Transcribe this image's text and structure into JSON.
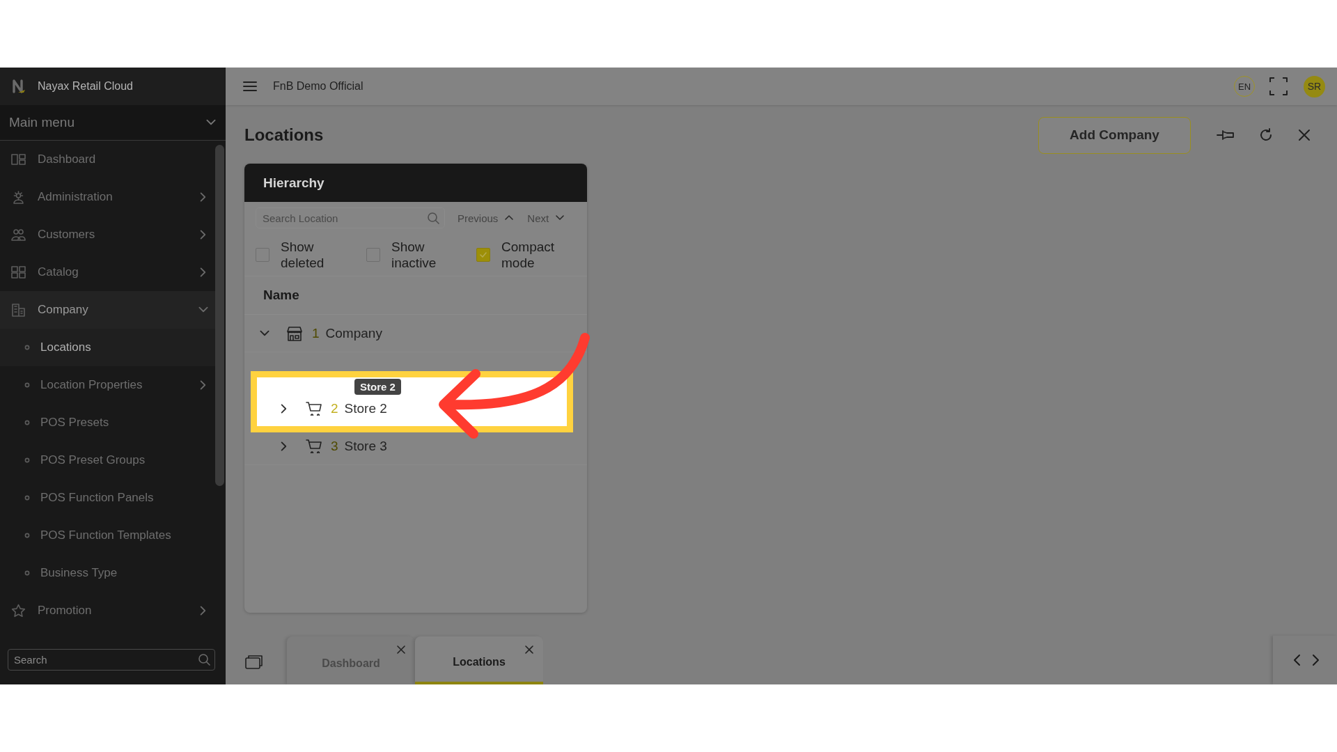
{
  "app": {
    "name": "Nayax Retail Cloud",
    "workspace": "FnB Demo Official"
  },
  "header": {
    "language": "EN",
    "user_initials": "SR"
  },
  "sidebar": {
    "menu_title": "Main menu",
    "items": [
      {
        "label": "Dashboard",
        "kind": "link",
        "selected": false
      },
      {
        "label": "Administration",
        "kind": "group",
        "selected": false,
        "expanded": false
      },
      {
        "label": "Customers",
        "kind": "group",
        "selected": false,
        "expanded": false
      },
      {
        "label": "Catalog",
        "kind": "group",
        "selected": false,
        "expanded": false
      },
      {
        "label": "Company",
        "kind": "group",
        "selected": true,
        "expanded": true,
        "children": [
          {
            "label": "Locations",
            "kind": "link",
            "selected": true
          },
          {
            "label": "Location Properties",
            "kind": "group",
            "selected": false,
            "expanded": false
          },
          {
            "label": "POS Presets",
            "kind": "link",
            "selected": false
          },
          {
            "label": "POS Preset Groups",
            "kind": "link",
            "selected": false
          },
          {
            "label": "POS Function Panels",
            "kind": "link",
            "selected": false
          },
          {
            "label": "POS Function Templates",
            "kind": "link",
            "selected": false
          },
          {
            "label": "Business Type",
            "kind": "link",
            "selected": false
          }
        ]
      },
      {
        "label": "Promotion",
        "kind": "group",
        "selected": false,
        "expanded": false
      }
    ],
    "search": {
      "placeholder": "Search"
    }
  },
  "page": {
    "title": "Locations",
    "primary_button": "Add Company"
  },
  "hierarchy": {
    "title": "Hierarchy",
    "search": {
      "placeholder": "Search Location"
    },
    "nav": [
      {
        "label": "Previous",
        "kind": "up"
      },
      {
        "label": "Next",
        "kind": "down"
      }
    ],
    "options": [
      {
        "label": "Show deleted",
        "checked": false
      },
      {
        "label": "Show inactive",
        "checked": false
      },
      {
        "label": "Compact mode",
        "checked": true
      }
    ],
    "columns": [
      "Name"
    ],
    "tree": [
      {
        "number": "1",
        "label": "Company",
        "kind": "company",
        "expanded": true,
        "highlighted": false,
        "children": [
          {
            "number": "2",
            "label": "Store 2",
            "kind": "store",
            "expanded": false,
            "highlighted": true,
            "tooltip": "Store 2"
          },
          {
            "number": "3",
            "label": "Store 3",
            "kind": "store",
            "expanded": false,
            "highlighted": false
          }
        ]
      }
    ]
  },
  "tabs": [
    {
      "label": "Dashboard",
      "selected": false
    },
    {
      "label": "Locations",
      "selected": true
    }
  ]
}
